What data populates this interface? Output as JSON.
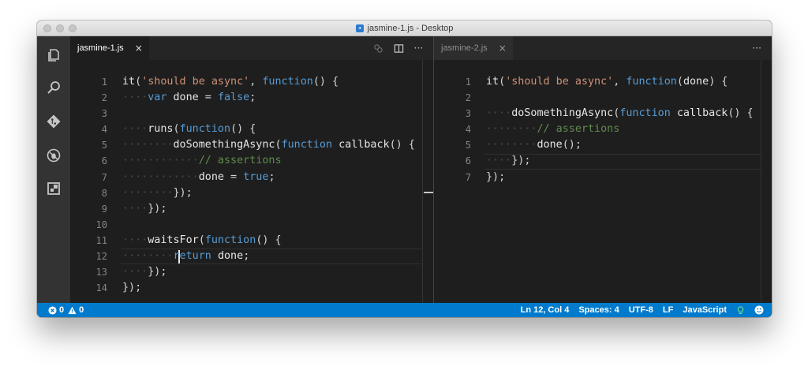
{
  "window": {
    "title": "jasmine-1.js - Desktop"
  },
  "colors": {
    "status_bar": "#007acc",
    "editor_bg": "#1e1e1e",
    "activity_bar": "#333333",
    "keyword": "#569cd6",
    "string": "#ce9178",
    "comment": "#608b4e"
  },
  "activity_bar": {
    "items": [
      {
        "icon": "explorer-files-icon"
      },
      {
        "icon": "search-icon"
      },
      {
        "icon": "source-control-git-icon"
      },
      {
        "icon": "debug-icon"
      },
      {
        "icon": "extensions-icon"
      }
    ]
  },
  "left_editor": {
    "tab": {
      "label": "jasmine-1.js",
      "close": "×"
    },
    "actions": {
      "more": "···"
    },
    "lines": [
      {
        "no": "1",
        "tokens": [
          [
            "id",
            "it"
          ],
          [
            "p",
            "("
          ],
          [
            "str",
            "'should be async'"
          ],
          [
            "p",
            ", "
          ],
          [
            "kw",
            "function"
          ],
          [
            "p",
            "() {"
          ]
        ]
      },
      {
        "no": "2",
        "tokens": [
          [
            "ws",
            "····"
          ],
          [
            "kw",
            "var"
          ],
          [
            "p",
            " "
          ],
          [
            "id",
            "done"
          ],
          [
            "p",
            " = "
          ],
          [
            "kw",
            "false"
          ],
          [
            "p",
            ";"
          ]
        ]
      },
      {
        "no": "3",
        "tokens": []
      },
      {
        "no": "4",
        "tokens": [
          [
            "ws",
            "····"
          ],
          [
            "id",
            "runs"
          ],
          [
            "p",
            "("
          ],
          [
            "kw",
            "function"
          ],
          [
            "p",
            "() {"
          ]
        ]
      },
      {
        "no": "5",
        "tokens": [
          [
            "ws",
            "········"
          ],
          [
            "id",
            "doSomethingAsync"
          ],
          [
            "p",
            "("
          ],
          [
            "kw",
            "function"
          ],
          [
            "p",
            " "
          ],
          [
            "id",
            "callback"
          ],
          [
            "p",
            "() {"
          ]
        ]
      },
      {
        "no": "6",
        "tokens": [
          [
            "ws",
            "············"
          ],
          [
            "cm",
            "// assertions"
          ]
        ]
      },
      {
        "no": "7",
        "tokens": [
          [
            "ws",
            "············"
          ],
          [
            "id",
            "done"
          ],
          [
            "p",
            " = "
          ],
          [
            "kw",
            "true"
          ],
          [
            "p",
            ";"
          ]
        ]
      },
      {
        "no": "8",
        "tokens": [
          [
            "ws",
            "········"
          ],
          [
            "p",
            "});"
          ]
        ]
      },
      {
        "no": "9",
        "tokens": [
          [
            "ws",
            "····"
          ],
          [
            "p",
            "});"
          ]
        ]
      },
      {
        "no": "10",
        "tokens": []
      },
      {
        "no": "11",
        "tokens": [
          [
            "ws",
            "····"
          ],
          [
            "id",
            "waitsFor"
          ],
          [
            "p",
            "("
          ],
          [
            "kw",
            "function"
          ],
          [
            "p",
            "() {"
          ]
        ]
      },
      {
        "no": "12",
        "tokens": [
          [
            "ws",
            "····"
          ],
          [
            "ws",
            "····"
          ],
          [
            "kw",
            "return"
          ],
          [
            "p",
            " "
          ],
          [
            "id",
            "done"
          ],
          [
            "p",
            ";"
          ]
        ]
      },
      {
        "no": "13",
        "tokens": [
          [
            "ws",
            "····"
          ],
          [
            "p",
            "});"
          ]
        ]
      },
      {
        "no": "14",
        "tokens": [
          [
            "p",
            "});"
          ]
        ]
      }
    ]
  },
  "right_editor": {
    "tab": {
      "label": "jasmine-2.js",
      "close": "×"
    },
    "actions": {
      "more": "···"
    },
    "lines": [
      {
        "no": "1",
        "tokens": [
          [
            "id",
            "it"
          ],
          [
            "p",
            "("
          ],
          [
            "str",
            "'should be async'"
          ],
          [
            "p",
            ", "
          ],
          [
            "kw",
            "function"
          ],
          [
            "p",
            "("
          ],
          [
            "id",
            "done"
          ],
          [
            "p",
            ") {"
          ]
        ]
      },
      {
        "no": "2",
        "tokens": []
      },
      {
        "no": "3",
        "tokens": [
          [
            "ws",
            "····"
          ],
          [
            "id",
            "doSomethingAsync"
          ],
          [
            "p",
            "("
          ],
          [
            "kw",
            "function"
          ],
          [
            "p",
            " "
          ],
          [
            "id",
            "callback"
          ],
          [
            "p",
            "() {"
          ]
        ]
      },
      {
        "no": "4",
        "tokens": [
          [
            "ws",
            "········"
          ],
          [
            "cm",
            "// assertions"
          ]
        ]
      },
      {
        "no": "5",
        "tokens": [
          [
            "ws",
            "········"
          ],
          [
            "id",
            "done"
          ],
          [
            "p",
            "();"
          ]
        ]
      },
      {
        "no": "6",
        "tokens": [
          [
            "ws",
            "····"
          ],
          [
            "p",
            "});"
          ]
        ]
      },
      {
        "no": "7",
        "tokens": [
          [
            "p",
            "});"
          ]
        ]
      }
    ]
  },
  "status_bar": {
    "errors": "0",
    "warnings": "0",
    "position": "Ln 12, Col 4",
    "indent": "Spaces: 4",
    "encoding": "UTF-8",
    "eol": "LF",
    "language": "JavaScript"
  }
}
